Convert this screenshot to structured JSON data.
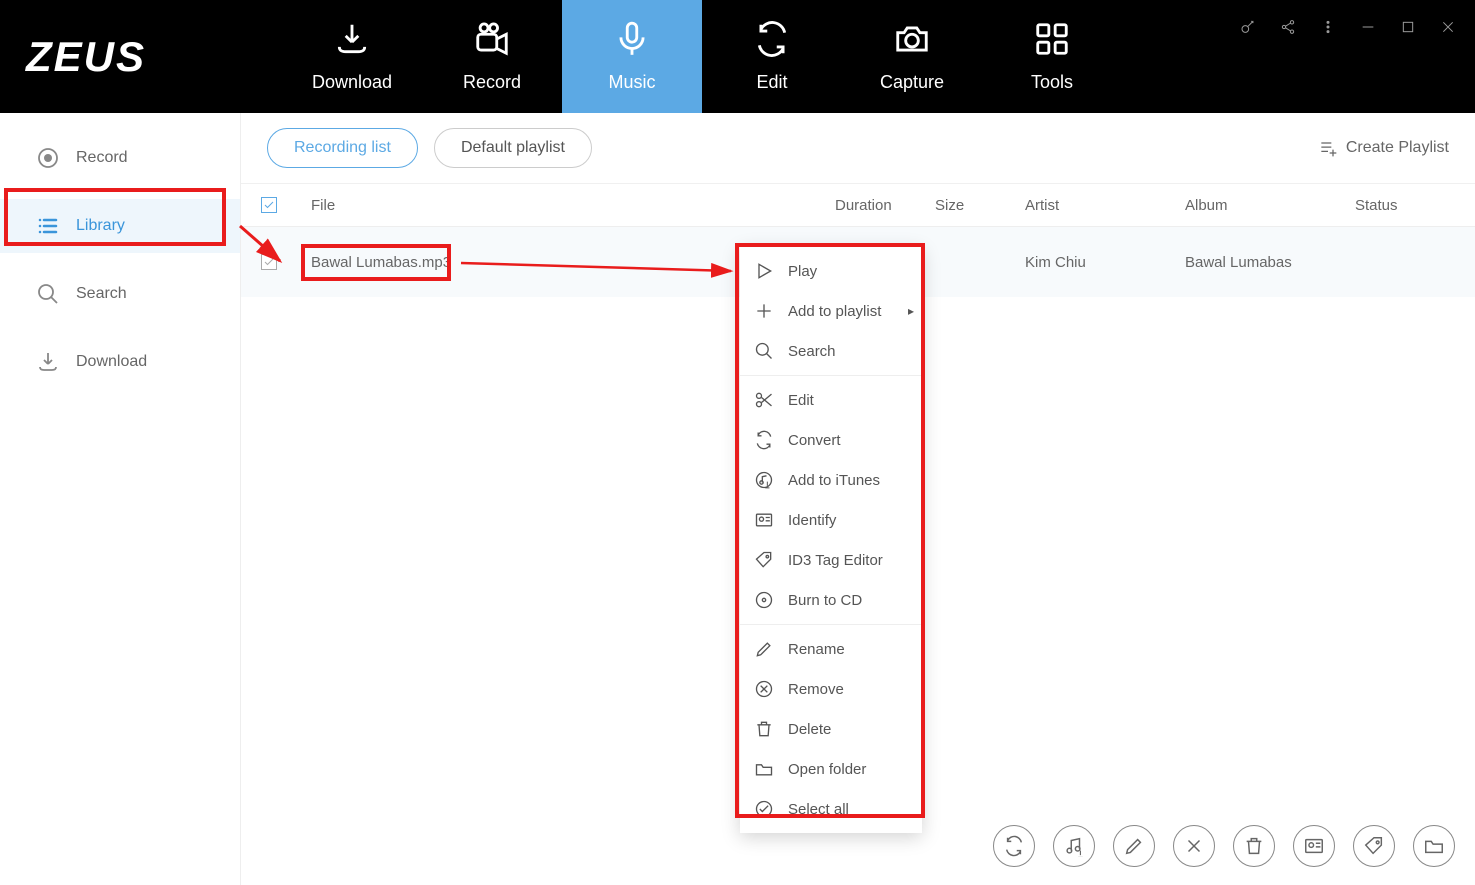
{
  "brand": "ZEUS",
  "nav": {
    "download": "Download",
    "record": "Record",
    "music": "Music",
    "edit": "Edit",
    "capture": "Capture",
    "tools": "Tools"
  },
  "sidebar": {
    "record": "Record",
    "library": "Library",
    "search": "Search",
    "download": "Download"
  },
  "toolbar": {
    "recording_list": "Recording list",
    "default_playlist": "Default playlist",
    "create_playlist": "Create Playlist"
  },
  "columns": {
    "file": "File",
    "duration": "Duration",
    "size": "Size",
    "artist": "Artist",
    "album": "Album",
    "status": "Status"
  },
  "rows": [
    {
      "file": "Bawal Lumabas.mp3",
      "duration": "",
      "size": "",
      "artist": "Kim Chiu",
      "album": "Bawal Lumabas",
      "status": ""
    }
  ],
  "context_menu": {
    "play": "Play",
    "add_to_playlist": "Add to playlist",
    "search": "Search",
    "edit": "Edit",
    "convert": "Convert",
    "add_to_itunes": "Add to iTunes",
    "identify": "Identify",
    "id3": "ID3 Tag Editor",
    "burn": "Burn to CD",
    "rename": "Rename",
    "remove": "Remove",
    "delete": "Delete",
    "open_folder": "Open folder",
    "select_all": "Select all"
  }
}
